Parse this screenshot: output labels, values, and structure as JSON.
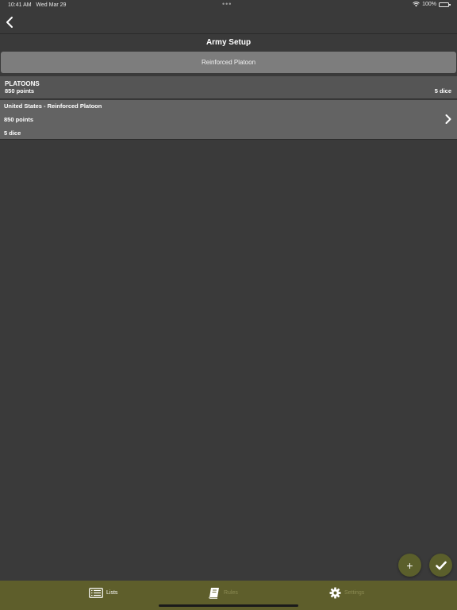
{
  "status_bar": {
    "time": "10:41 AM",
    "date": "Wed Mar 29",
    "dots": "•••",
    "battery": "100%"
  },
  "nav": {
    "back_icon": "chevron-left-icon"
  },
  "header": {
    "title": "Army Setup"
  },
  "army_selector": {
    "label": "Reinforced Platoon"
  },
  "section": {
    "title": "PLATOONS",
    "points": "850 points",
    "dice": "5 dice"
  },
  "platoons": [
    {
      "name": "United States - Reinforced Platoon",
      "points": "850 points",
      "dice": "5 dice"
    }
  ],
  "fabs": {
    "add_label": "+",
    "add_icon": "plus-icon",
    "confirm_icon": "checkmark-icon"
  },
  "tabs": {
    "lists": "Lists",
    "rules": "Rules",
    "settings": "Settings"
  },
  "colors": {
    "background": "#3a3a3a",
    "tab_bar": "#5e5e2b",
    "fab": "#5b5f2b",
    "active_tab": "#ffffff",
    "inactive_tab": "#8b8a52"
  }
}
